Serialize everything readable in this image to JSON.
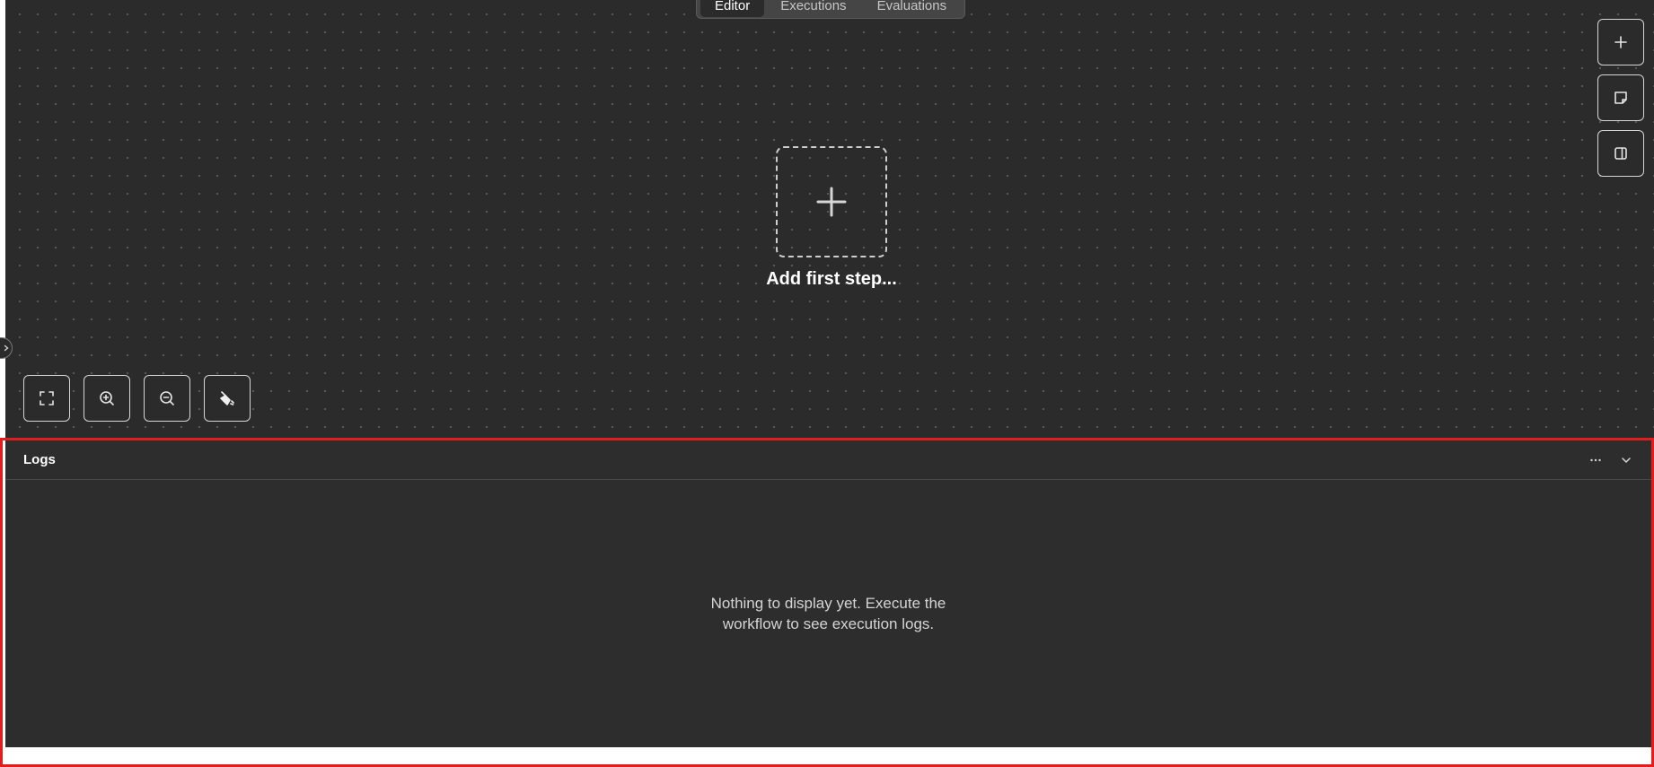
{
  "tabs": [
    {
      "label": "Editor",
      "active": true
    },
    {
      "label": "Executions",
      "active": false
    },
    {
      "label": "Evaluations",
      "active": false
    }
  ],
  "right_tools": [
    {
      "icon": "plus-icon",
      "tooltip": "Add node"
    },
    {
      "icon": "sticky-note-icon",
      "tooltip": "Add sticky note"
    },
    {
      "icon": "side-panel-icon",
      "tooltip": "Toggle panel"
    }
  ],
  "canvas": {
    "add_step_label": "Add first step..."
  },
  "canvas_controls": [
    {
      "icon": "fit-view-icon"
    },
    {
      "icon": "zoom-in-icon"
    },
    {
      "icon": "zoom-out-icon"
    },
    {
      "icon": "tidy-up-icon"
    }
  ],
  "logs": {
    "title": "Logs",
    "empty_message": "Nothing to display yet. Execute the workflow to see execution logs."
  },
  "colors": {
    "canvas_bg": "#2b2b2b",
    "panel_bg": "#2c2d2c",
    "highlight_border": "#e11d1d",
    "text_primary": "#ffffff"
  }
}
